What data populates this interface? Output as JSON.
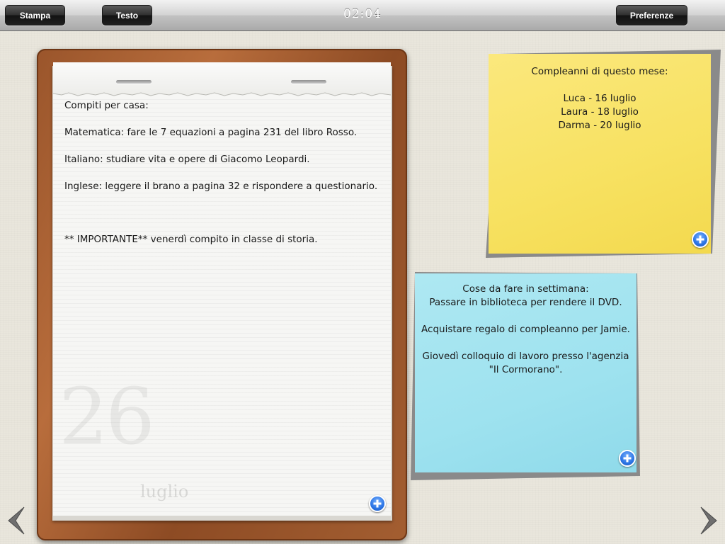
{
  "toolbar": {
    "print_label": "Stampa",
    "text_label": "Testo",
    "clock": "02:04",
    "preferences_label": "Preferenze"
  },
  "notepad": {
    "lines": [
      "Compiti per casa:",
      "Matematica: fare le 7 equazioni a pagina 231 del libro Rosso.",
      "Italiano: studiare vita e opere di Giacomo Leopardi.",
      "Inglese: leggere il brano a pagina 32 e rispondere a questionario.",
      "** IMPORTANTE** venerdì compito in classe di storia."
    ],
    "day": "26",
    "month": "luglio"
  },
  "yellow_note": {
    "lines": [
      "Compleanni di questo mese:",
      "",
      "Luca - 16 luglio",
      "Laura - 18 luglio",
      "Darma - 20 luglio"
    ],
    "color": "#f7e160"
  },
  "blue_note": {
    "lines": [
      "Cose da fare in settimana:",
      "Passare in biblioteca per rendere il DVD.",
      "",
      "Acquistare regalo di compleanno per Jamie.",
      "",
      "Giovedì colloquio di lavoro presso l'agenzia",
      "\"Il Cormorano\"."
    ],
    "color": "#9ee2ef"
  },
  "icons": {
    "add": "plus-icon",
    "prev": "chevron-left-icon",
    "next": "chevron-right-icon"
  },
  "colors": {
    "accent_blue": "#2b74e4",
    "wood": "#9a552b"
  }
}
